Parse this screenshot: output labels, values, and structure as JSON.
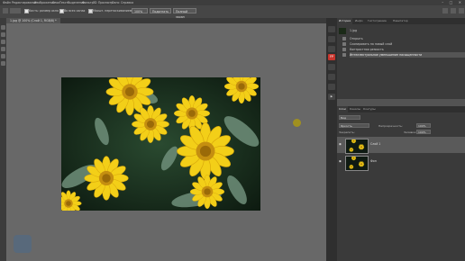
{
  "menu": [
    "Файл",
    "Редактирование",
    "Изображение",
    "Слои",
    "Текст",
    "Выделение",
    "Фильтр",
    "3D",
    "Просмотр",
    "Окно",
    "Справка"
  ],
  "options": {
    "sample_size": "Кисть: размер окна",
    "all_windows": "Во всех окнах",
    "scrubby_zoom": "Масшт. перетаскиванием",
    "zoom_value": "100%",
    "fit_screen": "Подогнать",
    "fill_screen": "Полный экран"
  },
  "document": {
    "tab_title": "1.jpg @ 100% (Слой 1, RGB/8) *"
  },
  "history": {
    "tabs": [
      "История",
      "Инфо",
      "Гистограмма",
      "Навигатор"
    ],
    "snapshot": "1.jpg",
    "items": [
      "Открыть",
      "Скопировать на новый слой",
      "Контрастная резкость",
      "Интеллектуальное уменьшение насыщенности"
    ]
  },
  "layers": {
    "tabs": [
      "Слои",
      "Каналы",
      "Контуры"
    ],
    "filter_label": "Вид",
    "blend_mode": "Яркость",
    "opacity_label": "Непрозрачность:",
    "opacity_value": "100%",
    "lock_label": "Закрепить:",
    "fill_label": "Заливка:",
    "fill_value": "100%",
    "rows": [
      {
        "name": "Слой 1"
      },
      {
        "name": "Фон"
      }
    ]
  },
  "colors": {
    "ps_red": "#c8352d",
    "selected_layer": "#5a5a5a"
  }
}
